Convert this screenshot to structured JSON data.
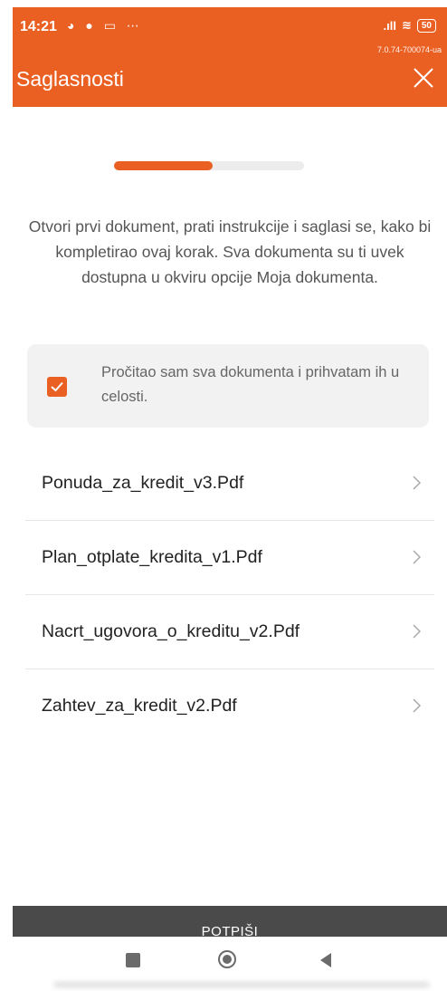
{
  "status_bar": {
    "time": "14:21",
    "left_icons": "◕ ● ▭ ⋯",
    "signal": ".ıll",
    "wifi": "≋",
    "battery": "50",
    "version": "7.0.74-700074-ua"
  },
  "header": {
    "title": "Saglasnosti",
    "close_icon": "close-icon"
  },
  "progress": {
    "value": 0.52
  },
  "instructions": "Otvori prvi dokument, prati instrukcije i saglasi se, kako bi kompletirao ovaj korak. Sva dokumenta su ti uvek dostupna u okviru opcije Moja dokumenta.",
  "consent": {
    "checked": true,
    "text": "Pročitao sam sva dokumenta i prihvatam ih u celosti."
  },
  "documents": [
    {
      "name": "Ponuda_za_kredit_v3.Pdf"
    },
    {
      "name": "Plan_otplate_kredita_v1.Pdf"
    },
    {
      "name": "Nacrt_ugovora_o_kreditu_v2.Pdf"
    },
    {
      "name": "Zahtev_za_kredit_v2.Pdf"
    }
  ],
  "sign_button": {
    "label": "POTPIŠI"
  },
  "colors": {
    "accent": "#EA6023",
    "sign_bar": "#4a4a4a"
  }
}
